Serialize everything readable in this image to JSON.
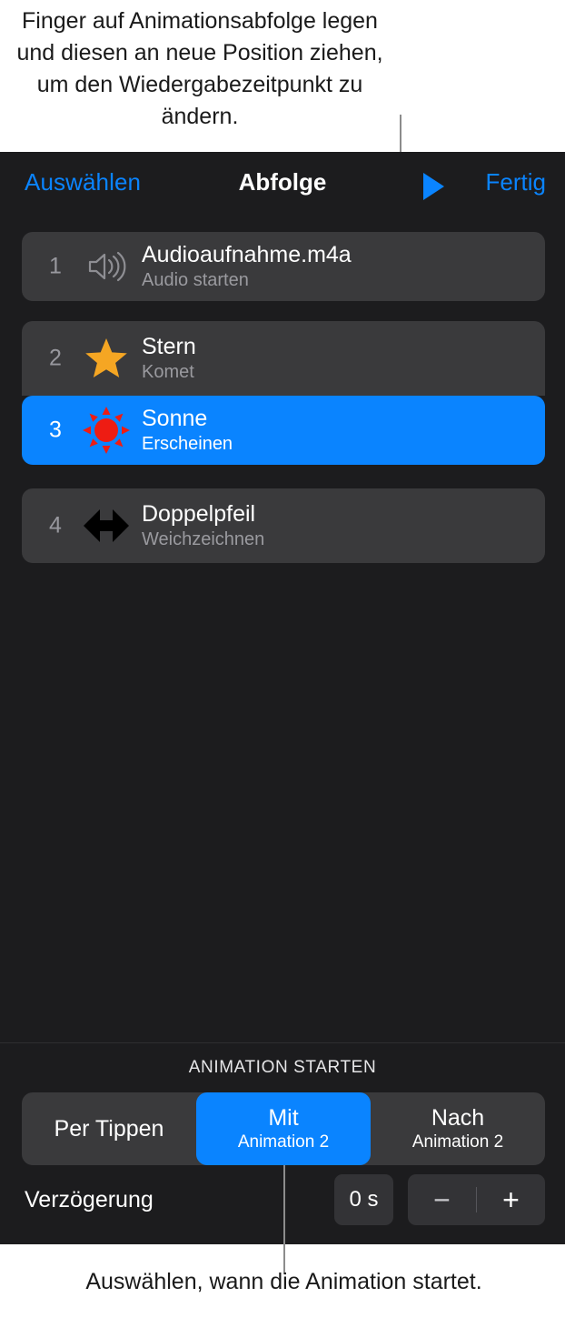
{
  "callouts": {
    "top": "Finger auf Animationsabfolge legen und diesen an neue Position ziehen, um den Wiedergabezeitpunkt zu ändern.",
    "bottom": "Auswählen, wann die Animation startet."
  },
  "navbar": {
    "select_label": "Auswählen",
    "title": "Abfolge",
    "play_icon": "play-icon",
    "done_label": "Fertig"
  },
  "list": {
    "rows": [
      {
        "index": "1",
        "icon": "speaker-wave-icon",
        "title": "Audioaufnahme.m4a",
        "subtitle": "Audio starten",
        "selected": false
      },
      {
        "index": "2",
        "icon": "star-icon",
        "title": "Stern",
        "subtitle": "Komet",
        "selected": false
      },
      {
        "index": "3",
        "icon": "sun-icon",
        "title": "Sonne",
        "subtitle": "Erscheinen",
        "selected": true
      },
      {
        "index": "4",
        "icon": "double-arrow-icon",
        "title": "Doppelpfeil",
        "subtitle": "Weichzeichnen",
        "selected": false
      }
    ]
  },
  "animation_start": {
    "section_title": "ANIMATION STARTEN",
    "segments": [
      {
        "main": "Per Tippen",
        "sub": "",
        "selected": false
      },
      {
        "main": "Mit",
        "sub": "Animation 2",
        "selected": true
      },
      {
        "main": "Nach",
        "sub": "Animation 2",
        "selected": false
      }
    ]
  },
  "delay": {
    "label": "Verzögerung",
    "value": "0 s",
    "minus_label": "−",
    "plus_label": "+"
  },
  "colors": {
    "accent": "#0a84ff",
    "panel_bg": "#1c1c1e",
    "row_bg": "#3a3a3c",
    "star": "#f5a623",
    "sun": "#ee1c13",
    "arrow": "#000000"
  }
}
